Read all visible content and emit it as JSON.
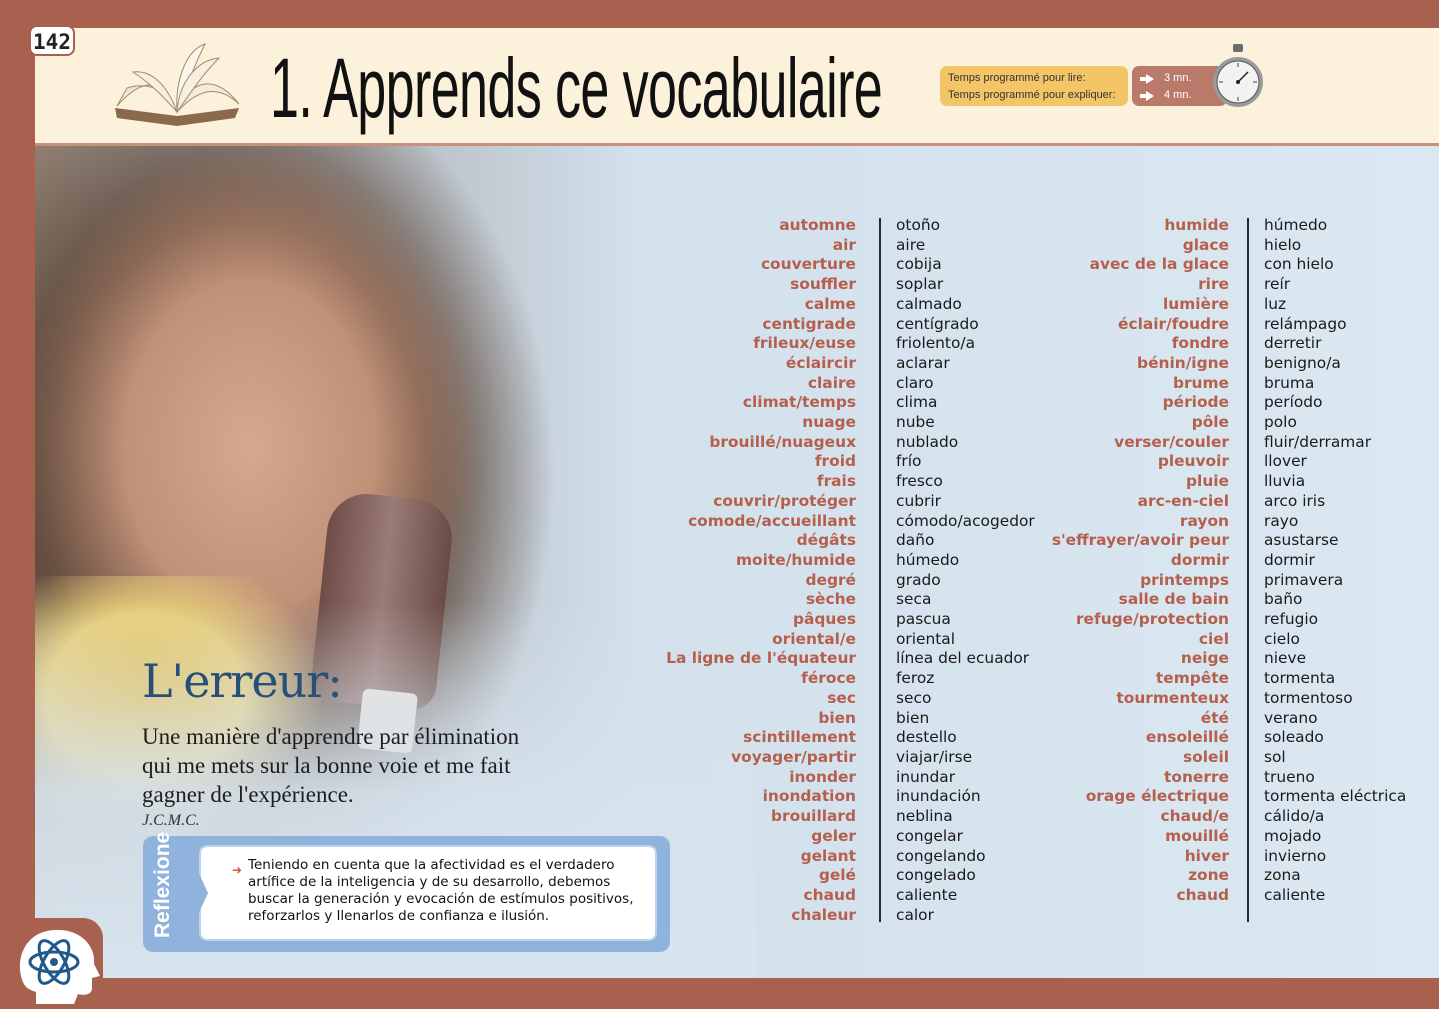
{
  "header": {
    "page_number": "142",
    "title": "1. Apprends ce vocabulaire",
    "time_label_read": "Temps programmé pour lire:",
    "time_label_explain": "Temps programmé pour expliquer:",
    "time_read": "3 mn.",
    "time_explain": "4 mn."
  },
  "quote": {
    "title": "L'erreur:",
    "text": "Une  manière d'apprendre par élimination qui me mets sur la bonne voie et me fait gagner de l'expérience.",
    "author": "J.C.M.C."
  },
  "reflexione": {
    "label": "Reflexione",
    "text": "Teniendo en cuenta que la afectividad es el verdadero artífice de la inteligencia y de su desarrollo, debemos buscar la generación y evocación de estímulos positivos, reforzarlos y llenarlos de confianza e ilusión."
  },
  "vocabulary": {
    "left_fr": [
      "automne",
      "air",
      "couverture",
      "souffler",
      "calme",
      "centigrade",
      "frileux/euse",
      "éclaircir",
      "claire",
      "climat/temps",
      "nuage",
      "brouillé/nuageux",
      "froid",
      "frais",
      "couvrir/protéger",
      "comode/accueillant",
      "dégâts",
      "moite/humide",
      "degré",
      "sèche",
      "pâques",
      "oriental/e",
      "La ligne de l'équateur",
      "féroce",
      "sec",
      "bien",
      "scintillement",
      "voyager/partir",
      "inonder",
      "inondation",
      "brouillard",
      "geler",
      "gelant",
      "gelé",
      "chaud",
      "chaleur"
    ],
    "left_es": [
      "otoño",
      "aire",
      "cobija",
      "soplar",
      "calmado",
      "centígrado",
      "friolento/a",
      "aclarar",
      "claro",
      "clima",
      "nube",
      "nublado",
      "frío",
      "fresco",
      "cubrir",
      "cómodo/acogedor",
      "daño",
      "húmedo",
      "grado",
      "seca",
      "pascua",
      "oriental",
      "línea del ecuador",
      "feroz",
      "seco",
      "bien",
      "destello",
      "viajar/irse",
      "inundar",
      "inundación",
      "neblina",
      "congelar",
      "congelando",
      "congelado",
      "caliente",
      "calor"
    ],
    "right_fr": [
      "humide",
      "glace",
      "avec de la glace",
      "rire",
      "lumière",
      "éclair/foudre",
      "fondre",
      "bénin/igne",
      "brume",
      "période",
      "pôle",
      "verser/couler",
      "pleuvoir",
      "pluie",
      "arc-en-ciel",
      "rayon",
      "s'effrayer/avoir peur",
      "dormir",
      "printemps",
      "salle de bain",
      "refuge/protection",
      "ciel",
      "neige",
      "tempête",
      "tourmenteux",
      "été",
      "ensoleillé",
      "soleil",
      "tonerre",
      "orage électrique",
      "chaud/e",
      "mouillé",
      "hiver",
      "zone",
      "chaud"
    ],
    "right_es": [
      "húmedo",
      "hielo",
      "con hielo",
      "reír",
      "luz",
      "relámpago",
      "derretir",
      "benigno/a",
      "bruma",
      "período",
      "polo",
      "fluir/derramar",
      "llover",
      "lluvia",
      "arco iris",
      "rayo",
      "asustarse",
      "dormir",
      "primavera",
      "baño",
      "refugio",
      "cielo",
      "nieve",
      "tormenta",
      "tormentoso",
      "verano",
      "soleado",
      "sol",
      "trueno",
      "tormenta eléctrica",
      "cálido/a",
      "mojado",
      "invierno",
      "zona",
      "caliente"
    ]
  },
  "colors": {
    "frame": "#a9614f",
    "french_word": "#b55f4c",
    "header_bg": "#fcf2dc",
    "accent_blue": "#264f7a",
    "reflex_blue": "#8fb3dc"
  },
  "icons": [
    "book-icon",
    "stopwatch-icon",
    "arrow-right-icon",
    "head-atom-icon"
  ]
}
